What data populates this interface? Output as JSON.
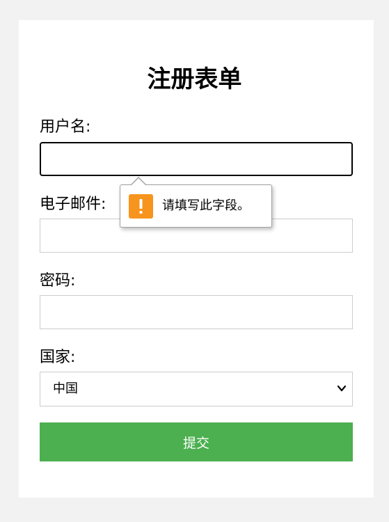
{
  "form": {
    "title": "注册表单",
    "fields": [
      {
        "label": "用户名:",
        "value": ""
      },
      {
        "label": "电子邮件:",
        "value": ""
      },
      {
        "label": "密码:",
        "value": ""
      },
      {
        "label": "国家:",
        "selected": "中国"
      }
    ],
    "submit_label": "提交"
  },
  "validation_tooltip": {
    "message": "请填写此字段。",
    "icon": "warning-icon",
    "icon_color": "#f7941d"
  },
  "colors": {
    "submit_bg": "#4caf50",
    "page_bg": "#f2f2f2"
  }
}
